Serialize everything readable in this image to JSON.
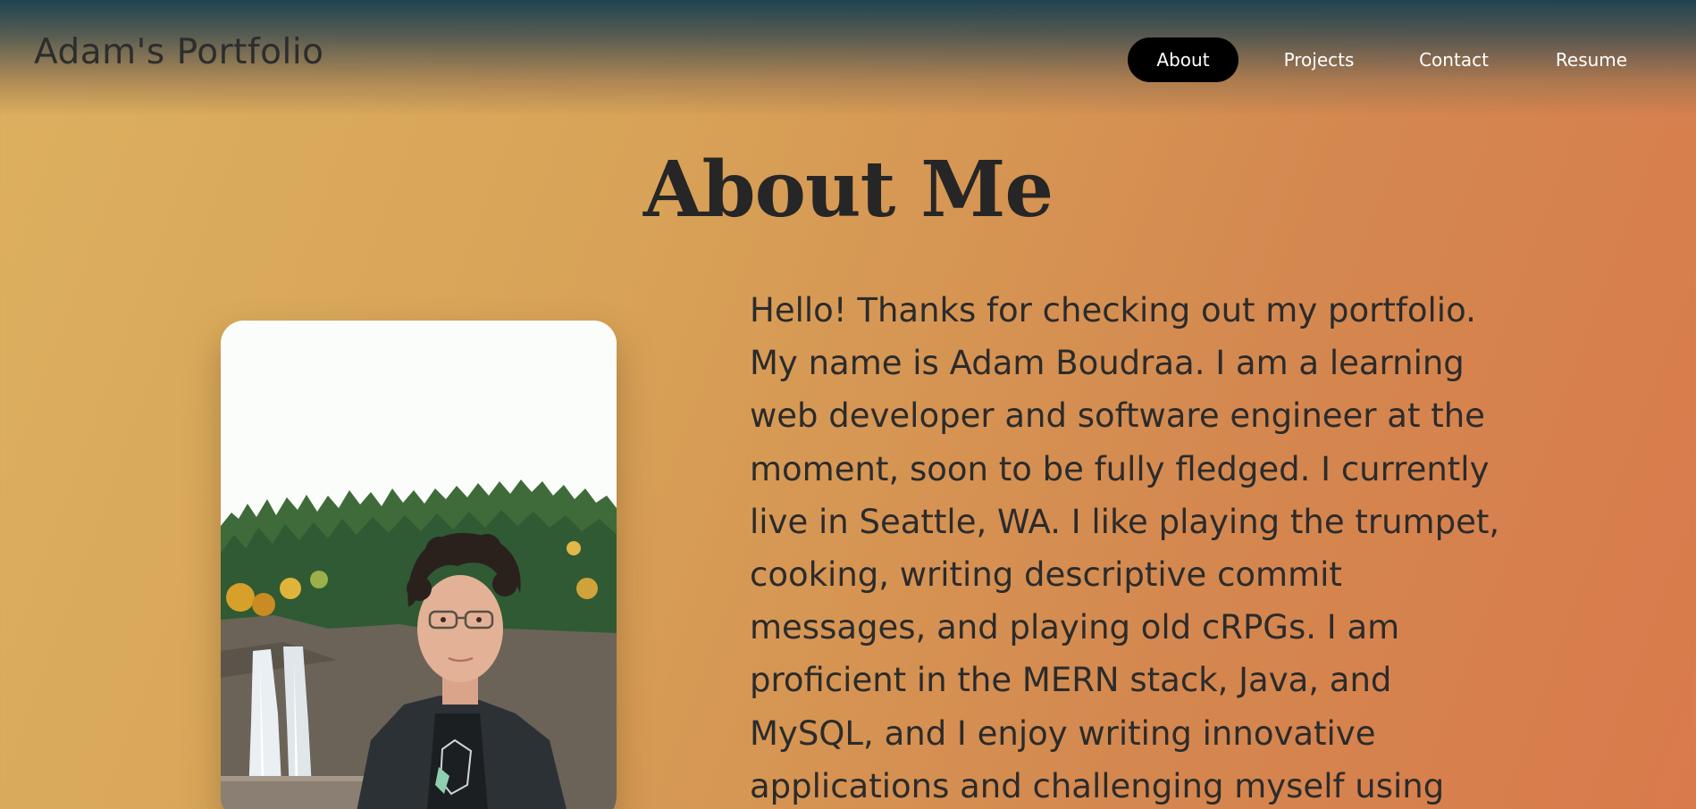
{
  "header": {
    "site_title": "Adam's Portfolio"
  },
  "nav": {
    "items": [
      {
        "label": "About",
        "active": true
      },
      {
        "label": "Projects",
        "active": false
      },
      {
        "label": "Contact",
        "active": false
      },
      {
        "label": "Resume",
        "active": false
      }
    ]
  },
  "main": {
    "heading": "About Me",
    "bio_lines": [
      "Hello! Thanks for checking out my portfolio.",
      "My name is Adam Boudraa. I am a learning",
      "web developer and software engineer at the",
      "moment, soon to be fully fledged. I currently",
      "live in Seattle, WA. I like playing the trumpet,",
      "cooking, writing descriptive commit",
      "messages, and playing old cRPGs. I am",
      "proficient in the MERN stack, Java, and",
      "MySQL, and I enjoy writing innovative",
      "applications and challenging myself using"
    ]
  },
  "colors": {
    "nav_active_bg": "#000000",
    "nav_text": "#ffffff",
    "header_top": "#1f4450",
    "bg_left": "#dcb05f",
    "bg_right": "#d97a4c",
    "text": "#2b2b2b"
  }
}
